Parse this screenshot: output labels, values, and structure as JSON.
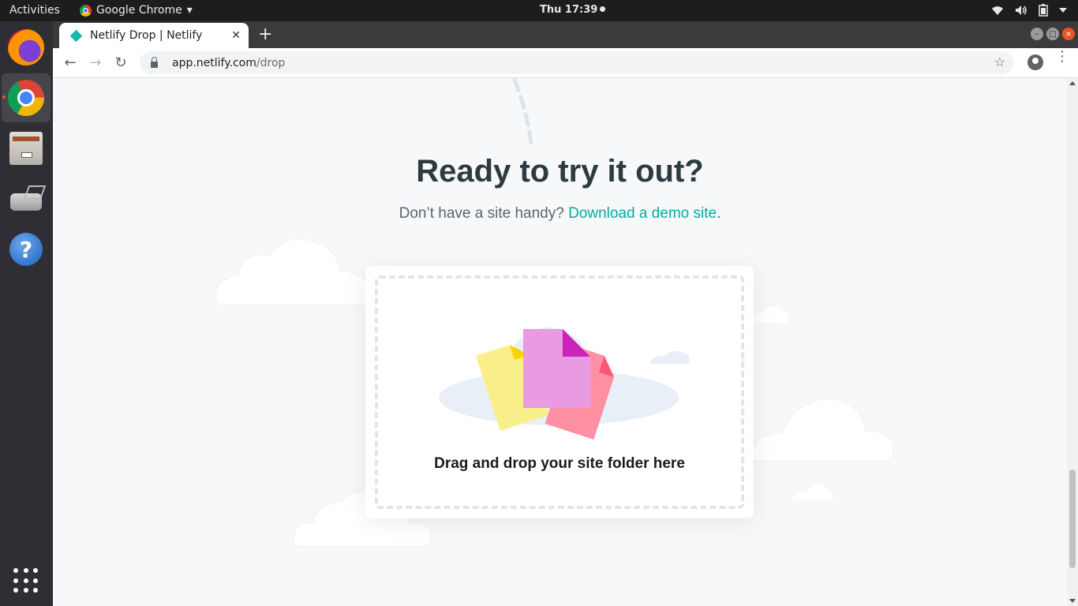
{
  "topbar": {
    "activities": "Activities",
    "app_name": "Google Chrome",
    "app_menu_arrow": "▾",
    "clock": "Thu 17:39",
    "tray": [
      "wifi-icon",
      "volume-icon",
      "battery-icon",
      "system-menu-icon"
    ]
  },
  "dock": {
    "items": [
      "firefox",
      "chrome",
      "files",
      "scanner",
      "help"
    ],
    "help_glyph": "?"
  },
  "browser": {
    "tab": {
      "title": "Netlify Drop | Netlify",
      "close": "✕"
    },
    "new_tab": "+",
    "nav": {
      "back": "←",
      "forward": "→",
      "reload": "↻"
    },
    "url": {
      "host": "app.netlify.com",
      "path": "/drop"
    },
    "star": "☆",
    "menu": "⋮"
  },
  "page": {
    "heading": "Ready to try it out?",
    "sub_prefix": "Don’t have a site handy? ",
    "sub_link": "Download a demo site",
    "sub_suffix": ".",
    "drop_label": "Drag and drop your site folder here"
  },
  "colors": {
    "accent": "#00ad9f",
    "heading": "#2d3b41",
    "file_yellow": "#f8ef8a",
    "file_purple": "#e89be1",
    "file_pink": "#ff8fa3"
  }
}
